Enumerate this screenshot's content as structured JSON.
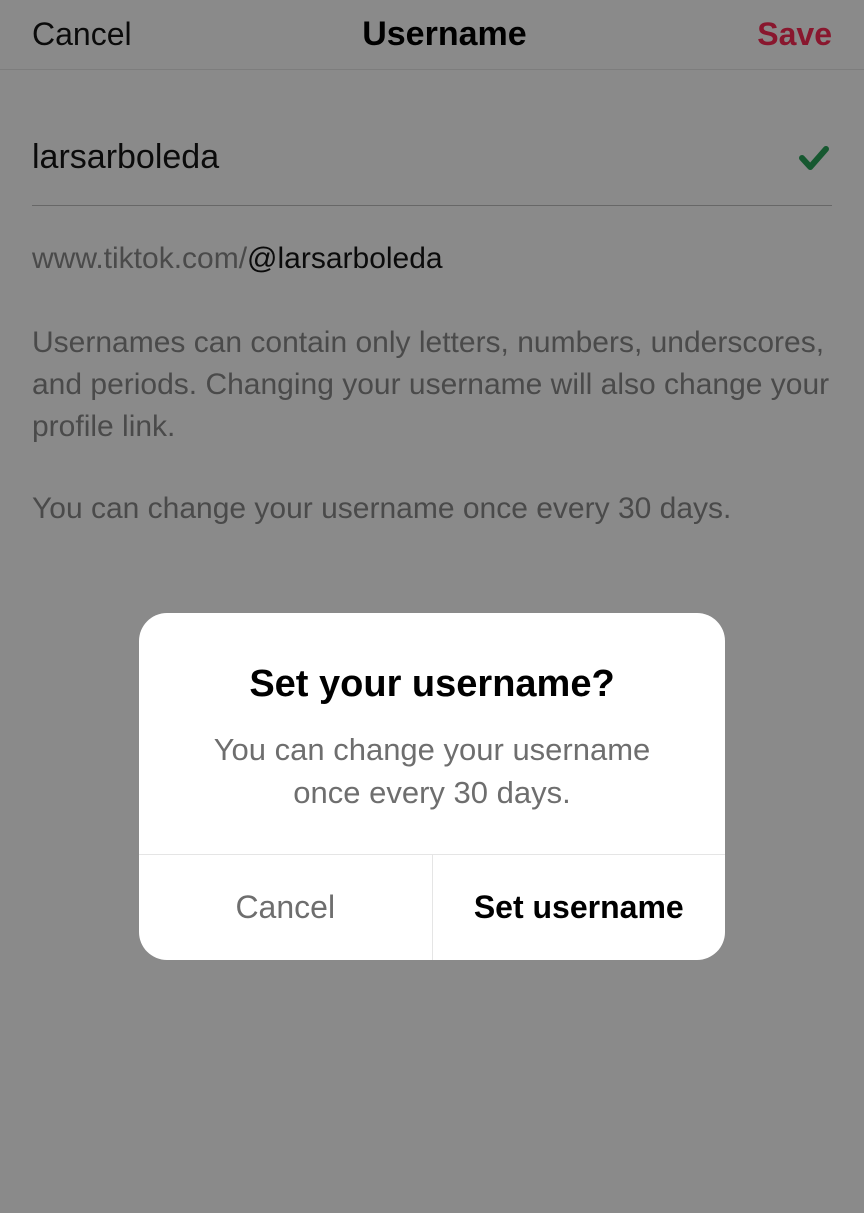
{
  "header": {
    "cancel_label": "Cancel",
    "title": "Username",
    "save_label": "Save"
  },
  "main": {
    "username_value": "larsarboleda",
    "profile_url_prefix": "www.tiktok.com/",
    "profile_url_handle": "@larsarboleda",
    "help1": "Usernames can contain only letters, numbers, underscores, and periods. Changing your username will also change your profile link.",
    "help2": "You can change your username once every 30 days."
  },
  "dialog": {
    "title": "Set your username?",
    "message": "You can change your username once every 30 days.",
    "cancel_label": "Cancel",
    "confirm_label": "Set username"
  },
  "colors": {
    "accent": "#fe2c55",
    "success": "#29a35a"
  }
}
